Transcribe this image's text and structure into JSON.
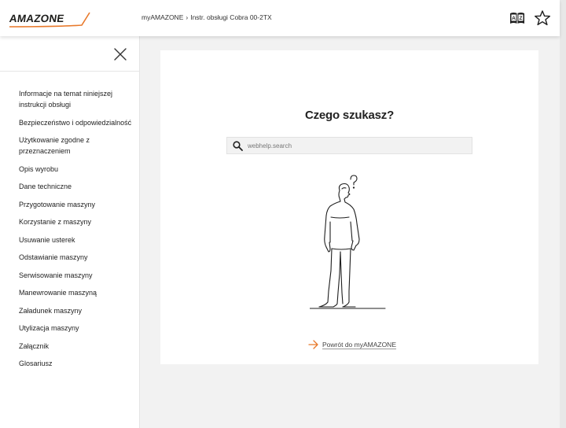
{
  "header": {
    "logo_text": "AMAZONE",
    "breadcrumb": [
      "myAMAZONE",
      "Instr. obsługi Cobra 00-2TX"
    ],
    "breadcrumb_separator": "›",
    "icons": [
      "glossary-book-icon",
      "star-icon"
    ]
  },
  "sidebar": {
    "items": [
      {
        "label": "Informacje na temat niniejszej instrukcji obsługi"
      },
      {
        "label": "Bezpieczeństwo i odpowiedzialność"
      },
      {
        "label": "Użytkowanie zgodne z przeznaczeniem"
      },
      {
        "label": "Opis wyrobu"
      },
      {
        "label": "Dane techniczne"
      },
      {
        "label": "Przygotowanie maszyny"
      },
      {
        "label": "Korzystanie z maszyny"
      },
      {
        "label": "Usuwanie usterek"
      },
      {
        "label": "Odstawianie maszyny"
      },
      {
        "label": "Serwisowanie maszyny"
      },
      {
        "label": "Manewrowanie maszyną"
      },
      {
        "label": "Załadunek maszyny"
      },
      {
        "label": "Utylizacja maszyny"
      },
      {
        "label": "Załącznik"
      },
      {
        "label": "Glosariusz"
      }
    ]
  },
  "main": {
    "title": "Czego szukasz?",
    "search": {
      "placeholder": "webhelp.search",
      "value": ""
    },
    "back_link": "Powrót do myAMAZONE",
    "figure_icon": "thinking-person-question-icon"
  },
  "colors": {
    "accent": "#e8792b",
    "page_bg": "#f2f2f2",
    "panel_bg": "#ffffff",
    "text": "#222222"
  }
}
